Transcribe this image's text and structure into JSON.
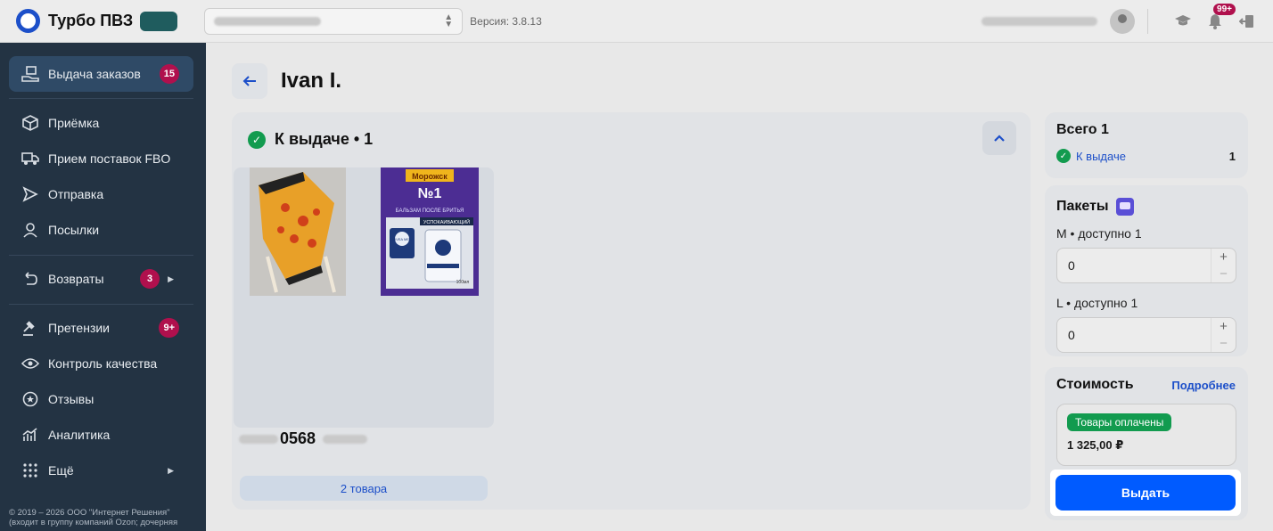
{
  "topbar": {
    "brand": "Турбо ПВЗ",
    "version": "Версия: 3.8.13",
    "notifications_badge": "99+"
  },
  "sidebar": {
    "active": {
      "label": "Выдача заказов",
      "badge": "15",
      "icon": "hand-box-icon"
    },
    "items": [
      {
        "label": "Приёмка",
        "icon": "box-icon"
      },
      {
        "label": "Прием поставок FBO",
        "icon": "truck-icon"
      },
      {
        "label": "Отправка",
        "icon": "send-icon"
      },
      {
        "label": "Посылки",
        "icon": "person-icon"
      },
      {
        "label": "Возвраты",
        "badge": "3",
        "icon": "return-icon"
      },
      {
        "label": "Претензии",
        "badge": "9+",
        "icon": "gavel-icon"
      },
      {
        "label": "Контроль качества",
        "icon": "eye-icon"
      },
      {
        "label": "Отзывы",
        "icon": "star-bubble-icon"
      },
      {
        "label": "Аналитика",
        "icon": "chart-icon"
      },
      {
        "label": "Ещё",
        "icon": "dots-grid-icon"
      }
    ],
    "copyright": "© 2019 – 2026 ООО \"Интернет Решения\" (входит в группу компаний Ozon; дочерняя"
  },
  "main": {
    "title": "Ivan I.",
    "group_title": "К выдаче • 1",
    "order": {
      "number": "0568",
      "items_button": "2 товара",
      "balm_texts": {
        "top": "Морожск",
        "num": "№1",
        "desc": "БАЛЬЗАМ ПОСЛЕ БРИТЬЯ",
        "strip": "УСПОКАИВАЮЩИЙ",
        "brand": "NIVEA MEN",
        "vol": "100мл"
      }
    }
  },
  "summary": {
    "title": "Всего 1",
    "status": "К выдаче",
    "count": "1"
  },
  "packages": {
    "title": "Пакеты",
    "m_label": "M • доступно 1",
    "m_value": "0",
    "l_label": "L • доступно 1",
    "l_value": "0"
  },
  "cost": {
    "title": "Стоимость",
    "details_link": "Подробнее",
    "paid_badge": "Товары оплачены",
    "price": "1 325,00 ₽"
  },
  "issue_button": "Выдать"
}
